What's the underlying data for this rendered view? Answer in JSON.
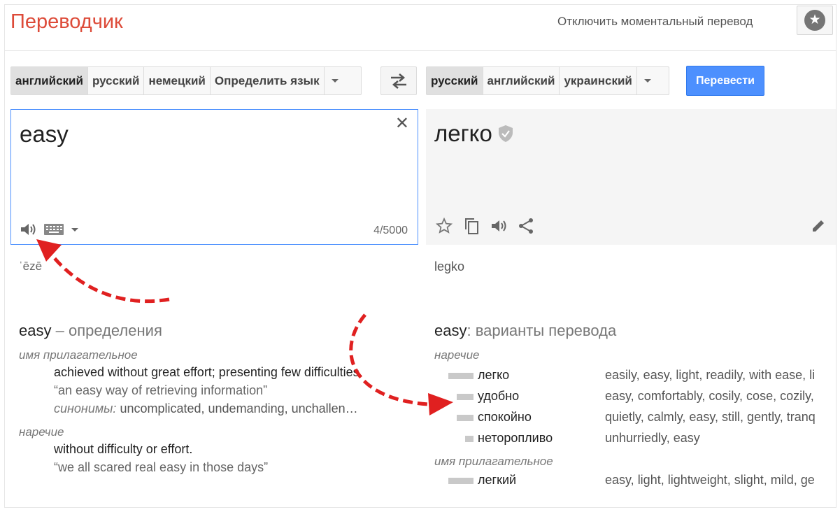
{
  "header": {
    "brand": "Переводчик",
    "instant_link": "Отключить моментальный перевод",
    "star_icon": "star-icon"
  },
  "source_langs": {
    "items": [
      "английский",
      "русский",
      "немецкий",
      "Определить язык"
    ],
    "active": "английский"
  },
  "target_langs": {
    "items": [
      "русский",
      "английский",
      "украинский"
    ],
    "active": "русский"
  },
  "translate_button": "Перевести",
  "source": {
    "text": "easy",
    "char_count": "4/5000",
    "transliteration": "ˈēzē"
  },
  "target": {
    "text": "легко",
    "transliteration": "legko"
  },
  "definitions": {
    "word": "easy",
    "title_suffix": "– определения",
    "groups": [
      {
        "pos": "имя прилагательное",
        "gloss": "achieved without great effort; presenting few difficulties.",
        "example": "“an easy way of retrieving information”",
        "synonyms_label": "синонимы:",
        "synonyms": "uncomplicated, undemanding, unchallen…"
      },
      {
        "pos": "наречие",
        "gloss": "without difficulty or effort.",
        "example": "“we all scared real easy in those days”"
      }
    ]
  },
  "variants": {
    "word": "easy",
    "title_suffix": ": варианты перевода",
    "groups": [
      {
        "pos": "наречие",
        "rows": [
          {
            "word": "легко",
            "reverse": "easily, easy, light, readily, with ease, li",
            "frequency": 1.0
          },
          {
            "word": "удобно",
            "reverse": "easy, comfortably, cosily, cose, cozily,",
            "frequency": 0.66
          },
          {
            "word": "спокойно",
            "reverse": "quietly, calmly, easy, still, gently, tranq",
            "frequency": 0.66
          },
          {
            "word": "неторопливо",
            "reverse": "unhurriedly, easy",
            "frequency": 0.33
          }
        ]
      },
      {
        "pos": "имя прилагательное",
        "rows": [
          {
            "word": "легкий",
            "reverse": "easy, light, lightweight, slight, mild, ge",
            "frequency": 1.0
          }
        ]
      }
    ]
  },
  "colors": {
    "brand": "#dd4b39",
    "primary_button": "#4d90fe",
    "annotation_arrow": "#e02020"
  }
}
